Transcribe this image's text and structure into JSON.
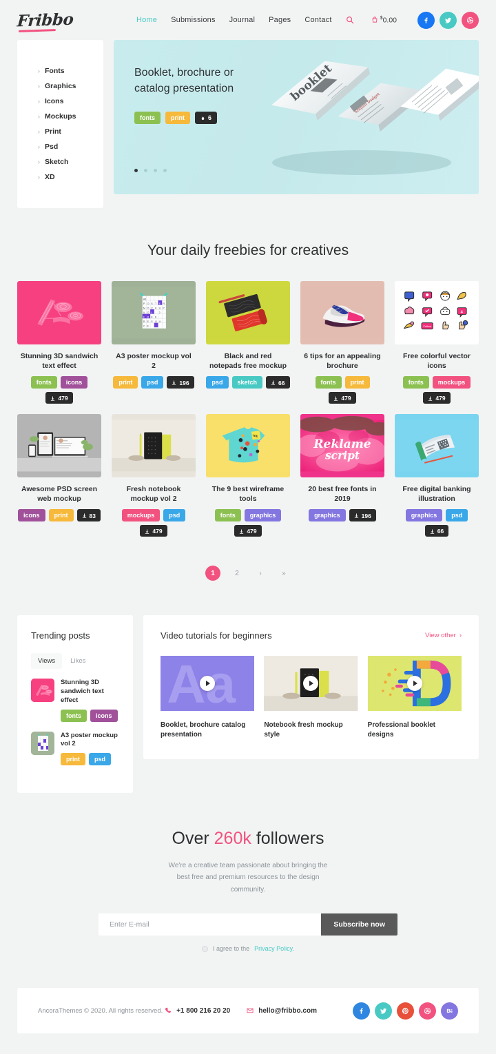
{
  "brand": {
    "name": "Fribbo",
    "accent": "#f2527f",
    "teal": "#49c9c3"
  },
  "header": {
    "nav": [
      {
        "label": "Home",
        "active": true
      },
      {
        "label": "Submissions",
        "active": false
      },
      {
        "label": "Journal",
        "active": false
      },
      {
        "label": "Pages",
        "active": false
      },
      {
        "label": "Contact",
        "active": false
      }
    ],
    "search_icon": "search-icon",
    "cart": {
      "icon": "cart-icon",
      "currency": "$",
      "amount": "0.00"
    },
    "socials": [
      {
        "name": "facebook",
        "glyph": "f",
        "color": "#1877f2"
      },
      {
        "name": "twitter",
        "glyph": "t",
        "color": "#49c9c3"
      },
      {
        "name": "dribbble",
        "glyph": "d",
        "color": "#f2527f"
      }
    ]
  },
  "categories": {
    "items": [
      {
        "label": "Fonts"
      },
      {
        "label": "Graphics"
      },
      {
        "label": "Icons"
      },
      {
        "label": "Mockups"
      },
      {
        "label": "Print"
      },
      {
        "label": "Psd"
      },
      {
        "label": "Sketch"
      },
      {
        "label": "XD"
      }
    ]
  },
  "hero": {
    "title": "Booklet, brochure or catalog presentation",
    "tags": [
      {
        "label": "fonts",
        "color": "#8cc152"
      },
      {
        "label": "print",
        "color": "#f6b93b"
      }
    ],
    "likes": {
      "icon": "fire-icon",
      "count": "6"
    },
    "dots": 4,
    "active_dot": 0
  },
  "freebies": {
    "title": "Your daily freebies for creatives",
    "cards": [
      {
        "title": "Stunning 3D sandwich text effect",
        "thumb": "pink-3d-text",
        "tags": [
          {
            "label": "fonts",
            "color": "#8cc152"
          },
          {
            "label": "icons",
            "color": "#a0519a"
          }
        ],
        "downloads": "479"
      },
      {
        "title": "A3 poster mockup vol 2",
        "thumb": "a3-poster",
        "tags": [
          {
            "label": "print",
            "color": "#f6b93b"
          },
          {
            "label": "psd",
            "color": "#3aa7e8"
          }
        ],
        "downloads": "196"
      },
      {
        "title": "Black and red notepads free mockup",
        "thumb": "notepads",
        "tags": [
          {
            "label": "psd",
            "color": "#3aa7e8"
          },
          {
            "label": "sketch",
            "color": "#49c9c3"
          }
        ],
        "downloads": "66"
      },
      {
        "title": "6 tips for an appealing brochure",
        "thumb": "sneaker",
        "tags": [
          {
            "label": "fonts",
            "color": "#8cc152"
          },
          {
            "label": "print",
            "color": "#f6b93b"
          }
        ],
        "downloads": "479"
      },
      {
        "title": "Free colorful vector icons",
        "thumb": "vector-icons",
        "tags": [
          {
            "label": "fonts",
            "color": "#8cc152"
          },
          {
            "label": "mockups",
            "color": "#f2527f"
          }
        ],
        "downloads": "479"
      },
      {
        "title": "Awesome PSD screen web mockup",
        "thumb": "screens",
        "tags": [
          {
            "label": "icons",
            "color": "#a0519a"
          },
          {
            "label": "print",
            "color": "#f6b93b"
          }
        ],
        "downloads": "83"
      },
      {
        "title": "Fresh notebook mockup vol 2",
        "thumb": "notebook",
        "tags": [
          {
            "label": "mockups",
            "color": "#f2527f"
          },
          {
            "label": "psd",
            "color": "#3aa7e8"
          }
        ],
        "downloads": "479"
      },
      {
        "title": "The 9 best wireframe tools",
        "thumb": "tshirt",
        "tags": [
          {
            "label": "fonts",
            "color": "#8cc152"
          },
          {
            "label": "graphics",
            "color": "#8376e0"
          }
        ],
        "downloads": "479"
      },
      {
        "title": "20 best free fonts in 2019",
        "thumb": "reklame",
        "tags": [
          {
            "label": "graphics",
            "color": "#8376e0"
          }
        ],
        "downloads": "196"
      },
      {
        "title": "Free digital banking illustration",
        "thumb": "banking",
        "tags": [
          {
            "label": "graphics",
            "color": "#8376e0"
          },
          {
            "label": "psd",
            "color": "#3aa7e8"
          }
        ],
        "downloads": "66"
      }
    ]
  },
  "pagination": {
    "pages": [
      "1",
      "2"
    ],
    "active": "1",
    "next_icon": "chevron-right-icon",
    "last_icon": "chevron-double-right-icon"
  },
  "trending": {
    "title": "Trending posts",
    "tabs": [
      {
        "label": "Views",
        "active": true
      },
      {
        "label": "Likes",
        "active": false
      }
    ],
    "items": [
      {
        "title": "Stunning 3D sandwich text effect",
        "thumb": "pink-3d-text",
        "tags": [
          {
            "label": "fonts",
            "color": "#8cc152"
          },
          {
            "label": "icons",
            "color": "#a0519a"
          }
        ]
      },
      {
        "title": "A3 poster mockup vol 2",
        "thumb": "a3-poster",
        "tags": [
          {
            "label": "print",
            "color": "#f6b93b"
          },
          {
            "label": "psd",
            "color": "#3aa7e8"
          }
        ]
      }
    ]
  },
  "videos": {
    "title": "Video tutorials for beginners",
    "view_other": "View other",
    "items": [
      {
        "title": "Booklet, brochure catalog presentation",
        "thumb": "aa-purple"
      },
      {
        "title": "Notebook fresh mockup style",
        "thumb": "notebook"
      },
      {
        "title": "Professional booklet designs",
        "thumb": "d-letter"
      }
    ]
  },
  "subscribe": {
    "title_pre": "Over ",
    "title_hl": "260k",
    "title_post": " followers",
    "description": "We're a creative team passionate about bringing the best free and premium resources to the design community.",
    "placeholder": "Enter E-mail",
    "value": "",
    "button": "Subscribe now",
    "agree_pre": "I agree to the ",
    "agree_link": "Privacy Policy."
  },
  "footer": {
    "copyright": "AncoraThemes © 2020. All rights reserved.",
    "phone": {
      "icon": "phone-icon",
      "text": "+1 800 216 20 20"
    },
    "email": {
      "icon": "mail-icon",
      "text": "hello@fribbo.com"
    },
    "socials": [
      {
        "name": "facebook",
        "color": "#2f86e0"
      },
      {
        "name": "twitter",
        "color": "#49c9c3"
      },
      {
        "name": "pinterest",
        "color": "#e8503a"
      },
      {
        "name": "dribbble",
        "color": "#f2527f"
      },
      {
        "name": "behance",
        "color": "#8376e0"
      }
    ]
  }
}
